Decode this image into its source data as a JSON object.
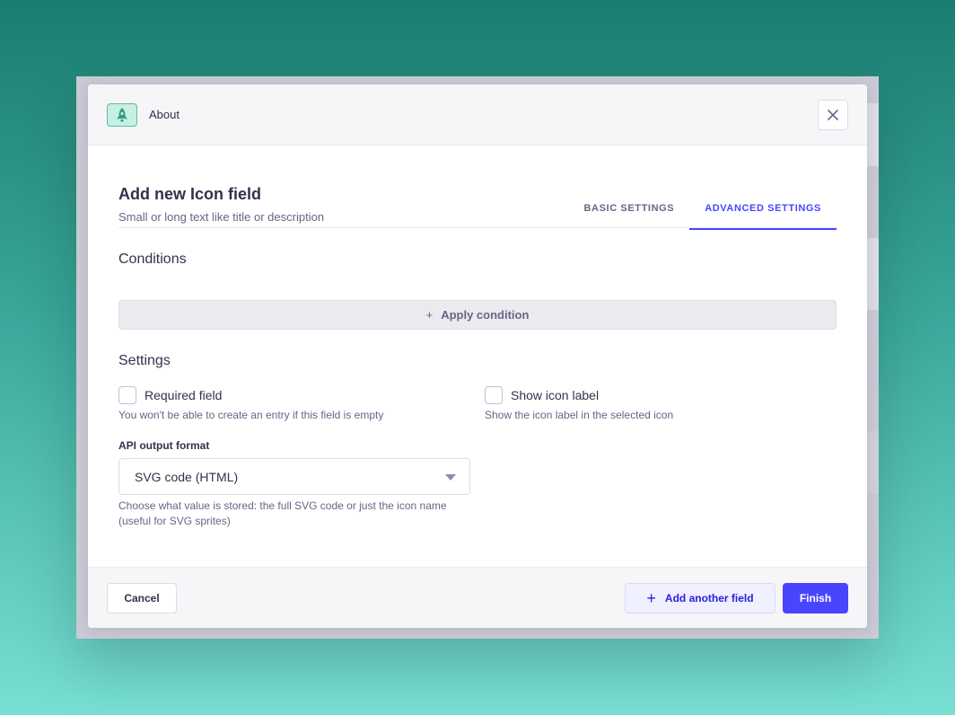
{
  "header": {
    "title": "About",
    "icon": "rocket-icon",
    "close_icon": "close-icon"
  },
  "field": {
    "title": "Add new Icon field",
    "subtitle": "Small or long text like title or description"
  },
  "tabs": [
    {
      "label": "BASIC SETTINGS",
      "active": false
    },
    {
      "label": "ADVANCED SETTINGS",
      "active": true
    }
  ],
  "conditions": {
    "title": "Conditions",
    "apply_button": "Apply condition"
  },
  "settings": {
    "title": "Settings",
    "required": {
      "label": "Required field",
      "hint": "You won't be able to create an entry if this field is empty",
      "checked": false
    },
    "show_label": {
      "label": "Show icon label",
      "hint": "Show the icon label in the selected icon",
      "checked": false
    },
    "api_output": {
      "label": "API output format",
      "value": "SVG code (HTML)",
      "hint": "Choose what value is stored: the full SVG code or just the icon name (useful for SVG sprites)"
    }
  },
  "footer": {
    "cancel_label": "Cancel",
    "add_another_label": "Add another field",
    "finish_label": "Finish"
  },
  "colors": {
    "primary": "#4945ff",
    "accent_green": "#66b7a3"
  }
}
